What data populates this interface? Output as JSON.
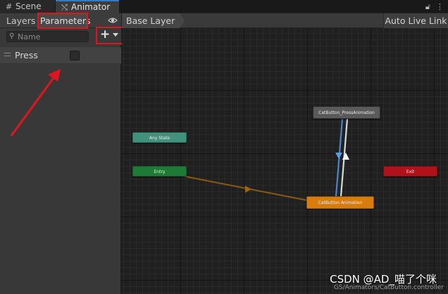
{
  "window_tabs": {
    "scene": {
      "label": "Scene",
      "icon": "grid-icon"
    },
    "animator": {
      "label": "Animator",
      "icon": "animator-icon"
    },
    "controls": {
      "lock_icon": "lock-icon",
      "menu_icon": "kebab-menu-icon"
    }
  },
  "left_panel": {
    "tabs": {
      "layers": "Layers",
      "parameters": "Parameters"
    },
    "search": {
      "placeholder": "Name",
      "value": ""
    },
    "parameters": [
      {
        "name": "Press",
        "type": "trigger",
        "value": false
      }
    ]
  },
  "graph": {
    "breadcrumb": "Base Layer",
    "auto_live_link": "Auto Live Link",
    "states": {
      "any": "Any State",
      "entry": "Entry",
      "exit": "Exit",
      "press": "CatButton_PressAnimation",
      "default": "CatButton Animation"
    },
    "file_path": "GS/Animators/CatButton.controller"
  },
  "watermark": "CSDN @AD_喵了个咪",
  "colors": {
    "highlight": "#e0151f",
    "any_state": "#41917d",
    "entry": "#1e7a35",
    "exit": "#b0111b",
    "default_state": "#d97c0e",
    "transition_entry": "#8b5a10",
    "transition_blue": "#4a86d0"
  }
}
